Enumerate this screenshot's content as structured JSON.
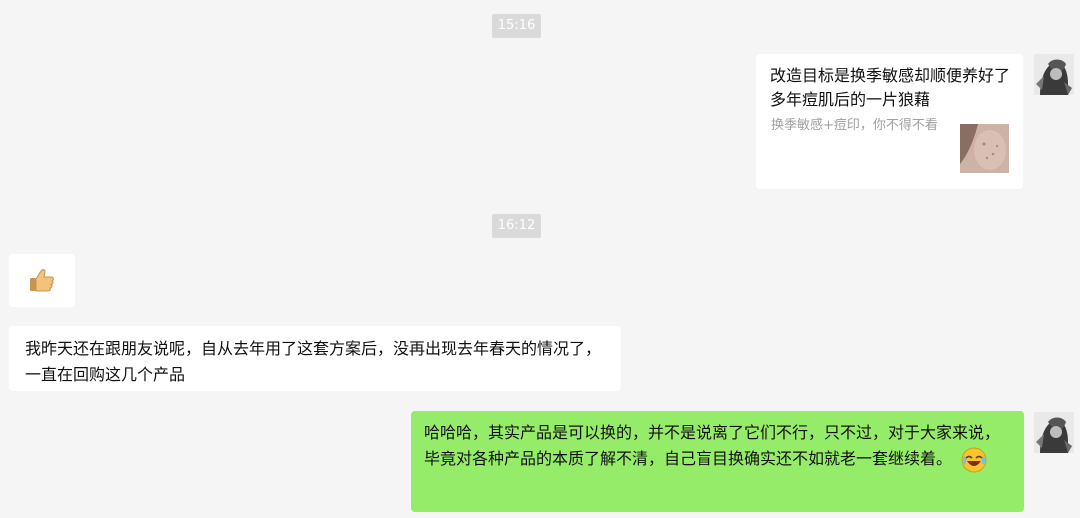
{
  "timestamps": [
    "15:16",
    "16:12"
  ],
  "messages": {
    "link_card": {
      "title": "改造目标是换季敏感却顺便养好了多年痘肌后的一片狼藉",
      "description": "换季敏感+痘印，你不得不看"
    },
    "thumbs_up": {
      "emoji": "thumbs-up-emoji"
    },
    "incoming_text": "我昨天还在跟朋友说呢，自从去年用了这套方案后，没再出现去年春天的情况了，一直在回购这几个产品",
    "outgoing_text": "哈哈哈，其实产品是可以换的，并不是说离了它们不行，只不过，对于大家来说，毕竟对各种产品的本质了解不清，自己盲目换确实还不如就老一套继续着。",
    "outgoing_emoji": "laughing-crying-emoji"
  },
  "colors": {
    "background": "#f5f5f5",
    "incoming_bubble": "#ffffff",
    "outgoing_bubble": "#95ec69",
    "timestamp_bg": "#dadada"
  }
}
